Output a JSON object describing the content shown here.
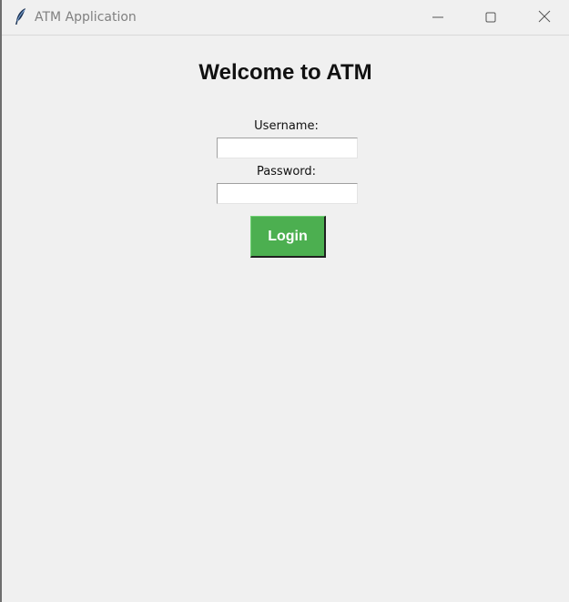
{
  "window": {
    "title": "ATM Application",
    "app_icon": "feather-icon",
    "controls": {
      "minimize_icon": "minimize-icon",
      "maximize_icon": "maximize-icon",
      "close_icon": "close-icon"
    }
  },
  "login": {
    "heading": "Welcome to ATM",
    "username_label": "Username:",
    "username_value": "",
    "password_label": "Password:",
    "password_value": "",
    "login_button_label": "Login"
  },
  "colors": {
    "background": "#f0f0f0",
    "login_button": "#4caf50",
    "login_button_text": "#ffffff",
    "title_text": "#808080"
  }
}
